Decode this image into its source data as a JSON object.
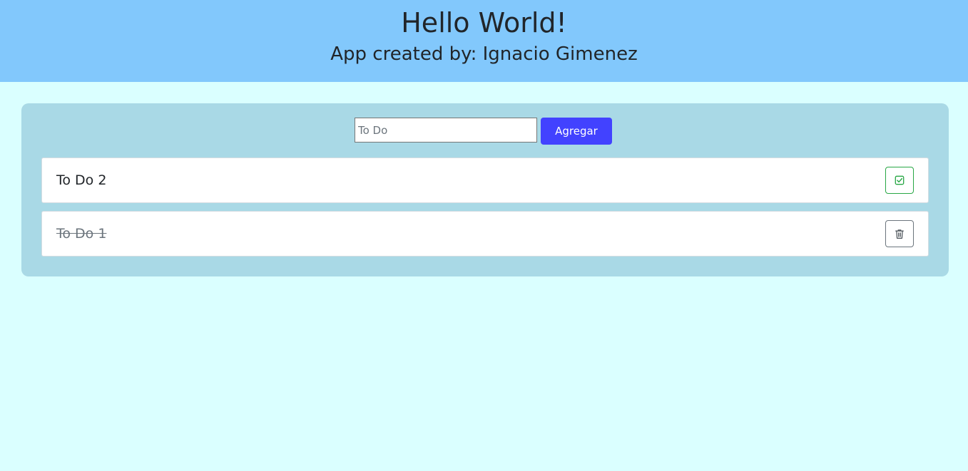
{
  "header": {
    "title": "Hello World!",
    "subtitle": "App created by: Ignacio Gimenez"
  },
  "form": {
    "input_value": "",
    "input_placeholder": "To Do",
    "add_label": "Agregar"
  },
  "todos": [
    {
      "text": "To Do 2",
      "done": false,
      "action": "check-square-icon"
    },
    {
      "text": "To Do 1",
      "done": true,
      "action": "trash-icon"
    }
  ],
  "colors": {
    "page_background": "#daffff",
    "header_background": "#82c8fc",
    "panel_background": "#a9d9e6",
    "primary_button": "#4242ff",
    "success": "#28a745",
    "secondary": "#6c757d"
  }
}
